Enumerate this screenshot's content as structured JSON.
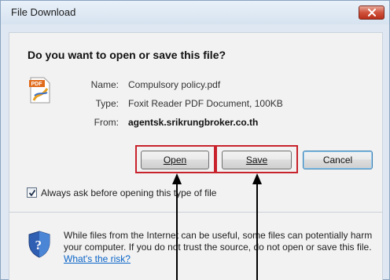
{
  "window": {
    "title": "File Download"
  },
  "dialog": {
    "question": "Do you want to open or save this file?",
    "file_icon": "pdf-file-icon",
    "fields": {
      "name_label": "Name:",
      "name_value": "Compulsory policy.pdf",
      "type_label": "Type:",
      "type_value": "Foxit Reader PDF Document, 100KB",
      "from_label": "From:",
      "from_value": "agentsk.srikrungbroker.co.th"
    },
    "buttons": {
      "open": "Open",
      "save": "Save",
      "cancel": "Cancel"
    },
    "checkbox": {
      "checked": true,
      "label": "Always ask before opening this type of file"
    },
    "warning": {
      "icon": "security-shield-icon",
      "text": "While files from the Internet can be useful, some files can potentially harm your computer. If you do not trust the source, do not open or save this file.",
      "link": "What's the risk?"
    }
  },
  "annotations": {
    "highlight_color": "#c8232c",
    "arrow_color": "#000000"
  }
}
